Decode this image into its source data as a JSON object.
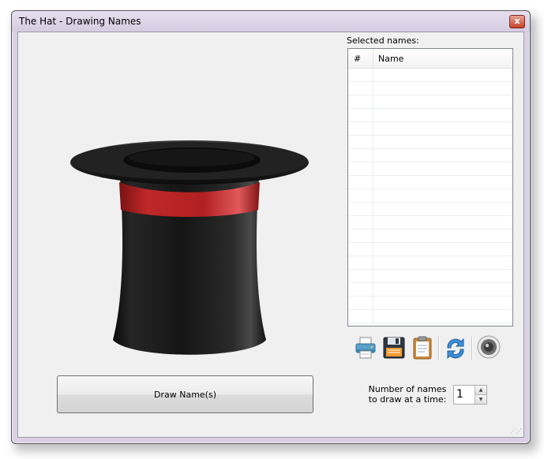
{
  "window": {
    "title": "The Hat - Drawing Names",
    "close_glyph": "x"
  },
  "selected": {
    "label": "Selected names:",
    "columns": [
      "#",
      "Name"
    ],
    "rows": []
  },
  "toolbar": {
    "icons": [
      "printer-icon",
      "save-icon",
      "clipboard-icon",
      "refresh-icon",
      "speaker-icon"
    ]
  },
  "draw_button": {
    "label": "Draw Name(s)"
  },
  "count": {
    "label_line1": "Number of names",
    "label_line2": "to draw at a time:",
    "value": "1"
  },
  "colors": {
    "hat_band": "#c0282a",
    "hat_body": "#1a1a1a",
    "window_frame": "#d9d1e3"
  }
}
